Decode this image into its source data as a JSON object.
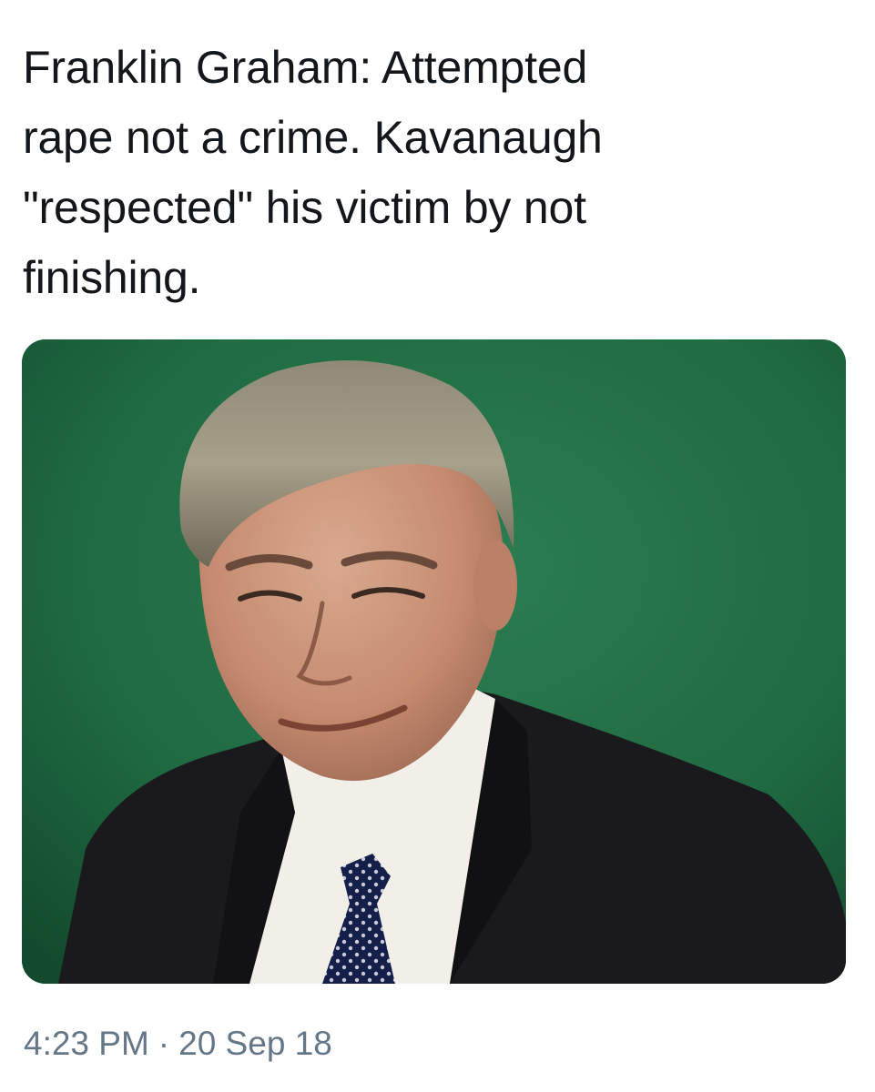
{
  "tweet": {
    "text": "Franklin Graham: Attempted\nrape not a crime. Kavanaugh\n\"respected\" his victim by not\nfinishing.",
    "time": "4:23 PM",
    "separator": "·",
    "date": "20 Sep 18"
  },
  "media": {
    "icon": "portrait-photo-icon"
  },
  "colors": {
    "text": "#14171a",
    "meta": "#657786",
    "photo_background": "#1f6a42"
  }
}
